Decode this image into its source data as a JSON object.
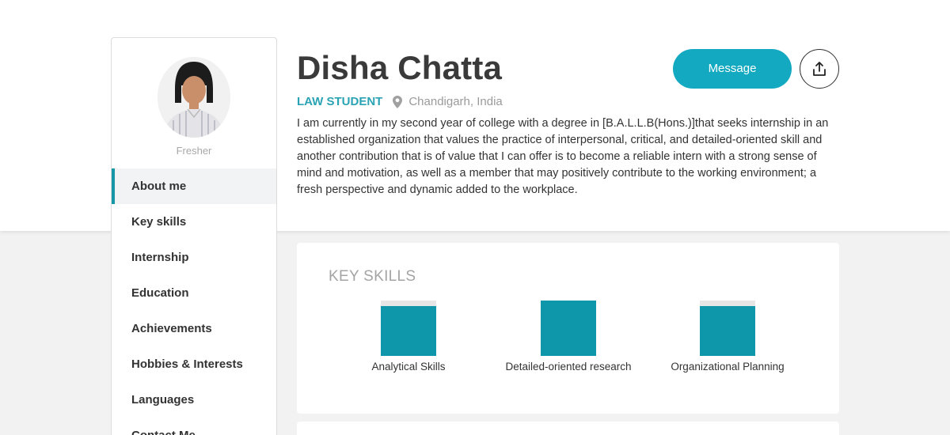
{
  "profile": {
    "name": "Disha Chatta",
    "role": "LAW STUDENT",
    "location": "Chandigarh, India",
    "status": "Fresher",
    "about": "I am currently in my second year of college with a degree in [B.A.L.L.B(Hons.)]that seeks internship in an established organization that values the practice of interpersonal, critical, and detailed-oriented skill and another contribution that is of value that I can offer is to become a reliable intern with a strong sense of mind and motivation, as well as a member that may positively contribute to the working environment; a fresh perspective and dynamic added to the workplace."
  },
  "actions": {
    "message_label": "Message",
    "share_icon": "share-icon"
  },
  "sidebar": {
    "items": [
      {
        "label": "About me",
        "active": true
      },
      {
        "label": "Key skills"
      },
      {
        "label": "Internship"
      },
      {
        "label": "Education"
      },
      {
        "label": "Achievements"
      },
      {
        "label": "Hobbies & Interests"
      },
      {
        "label": "Languages"
      },
      {
        "label": "Contact Me"
      }
    ]
  },
  "key_skills": {
    "title": "KEY SKILLS",
    "skills": [
      {
        "label": "Analytical Skills",
        "level": 0.9
      },
      {
        "label": "Detailed-oriented research",
        "level": 1.0
      },
      {
        "label": "Organizational Planning",
        "level": 0.9
      }
    ]
  },
  "colors": {
    "accent": "#13a9c1",
    "skill_bar": "#0e97ab",
    "role_text": "#2aa3b4"
  }
}
